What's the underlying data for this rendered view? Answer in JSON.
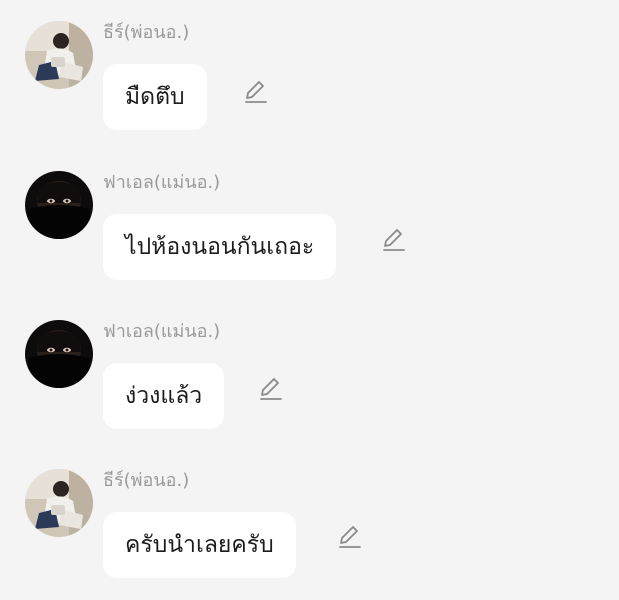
{
  "colors": {
    "background": "#f4f4f4",
    "bubble": "#ffffff",
    "sender_text": "#9a9a9a",
    "message_text": "#1c1c1c",
    "icon": "#8a8a8a"
  },
  "messages": [
    {
      "sender": "ธีร์(พ่อนอ.)",
      "text": "มืดตึบ",
      "avatar_icon": "avatar-photo-icon",
      "edit_icon": "pencil-edit-icon"
    },
    {
      "sender": "ฟาเอล(แม่นอ.)",
      "text": "ไปห้องนอนกันเถอะ",
      "avatar_icon": "avatar-photo-icon",
      "edit_icon": "pencil-edit-icon"
    },
    {
      "sender": "ฟาเอล(แม่นอ.)",
      "text": "ง่วงแล้ว",
      "avatar_icon": "avatar-photo-icon",
      "edit_icon": "pencil-edit-icon"
    },
    {
      "sender": "ธีร์(พ่อนอ.)",
      "text": "ครับนำเลยครับ",
      "avatar_icon": "avatar-photo-icon",
      "edit_icon": "pencil-edit-icon"
    }
  ]
}
